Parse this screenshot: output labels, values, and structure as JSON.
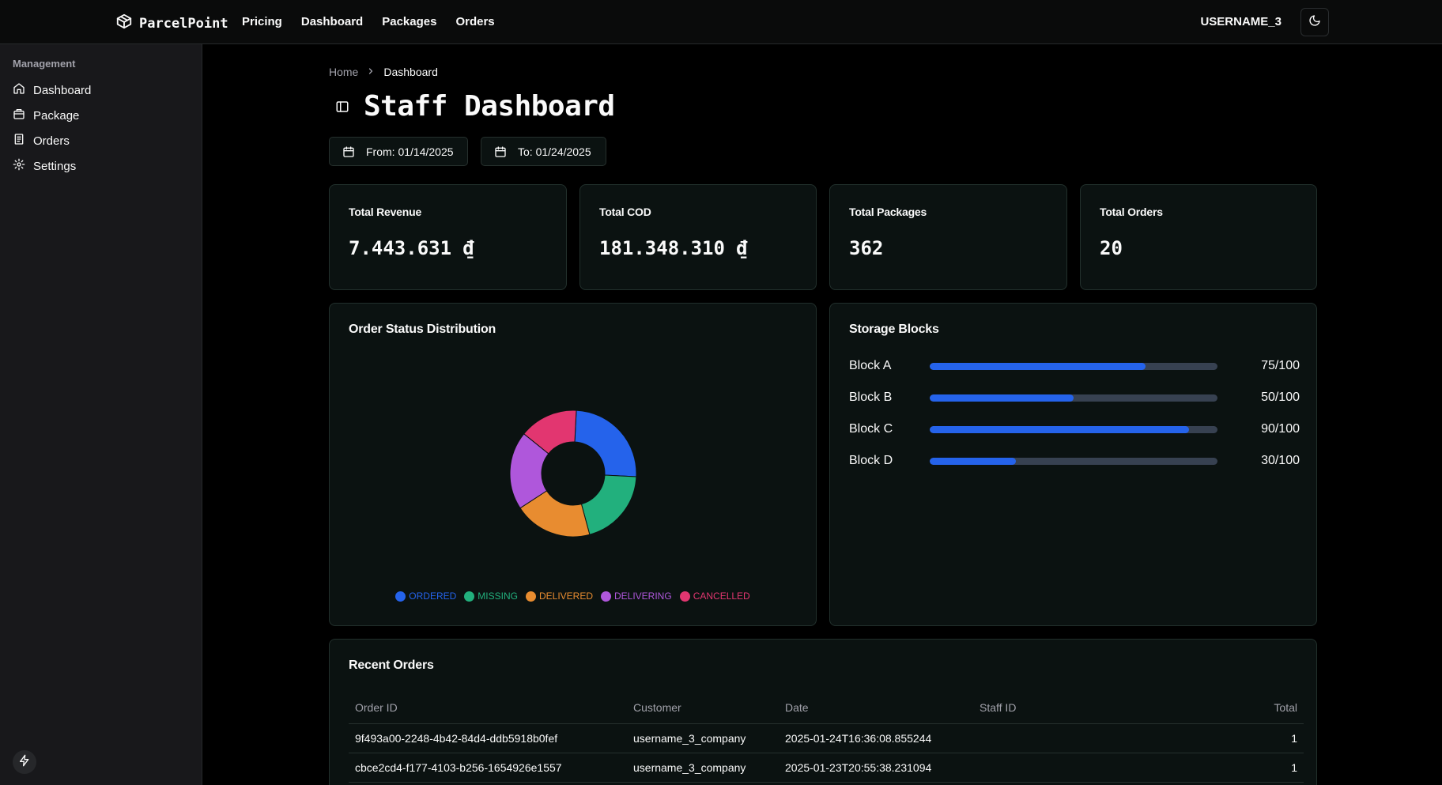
{
  "header": {
    "brand": "ParcelPoint",
    "nav": [
      "Pricing",
      "Dashboard",
      "Packages",
      "Orders"
    ],
    "username": "USERNAME_3"
  },
  "sidebar": {
    "group_label": "Management",
    "items": [
      {
        "label": "Dashboard",
        "icon": "home-icon"
      },
      {
        "label": "Package",
        "icon": "package-icon"
      },
      {
        "label": "Orders",
        "icon": "orders-icon"
      },
      {
        "label": "Settings",
        "icon": "gear-icon"
      }
    ]
  },
  "breadcrumb": {
    "home": "Home",
    "current": "Dashboard"
  },
  "page": {
    "title": "Staff Dashboard",
    "from_date": "From: 01/14/2025",
    "to_date": "To: 01/24/2025"
  },
  "stats": [
    {
      "label": "Total Revenue",
      "value": "7.443.631 ₫"
    },
    {
      "label": "Total COD",
      "value": "181.348.310 ₫"
    },
    {
      "label": "Total Packages",
      "value": "362"
    },
    {
      "label": "Total Orders",
      "value": "20"
    }
  ],
  "status_chart": {
    "title": "Order Status Distribution"
  },
  "chart_data": {
    "type": "pie",
    "title": "Order Status Distribution",
    "categories": [
      "ORDERED",
      "MISSING",
      "DELIVERED",
      "DELIVERING",
      "CANCELLED"
    ],
    "values": [
      5,
      4,
      4,
      4,
      3
    ],
    "colors": [
      "#2563eb",
      "#22b07d",
      "#e88c30",
      "#af57db",
      "#e23670"
    ],
    "legend": "bottom",
    "donut": true
  },
  "storage": {
    "title": "Storage Blocks",
    "blocks": [
      {
        "name": "Block A",
        "used": 75,
        "capacity": 100,
        "label": "75/100"
      },
      {
        "name": "Block B",
        "used": 50,
        "capacity": 100,
        "label": "50/100"
      },
      {
        "name": "Block C",
        "used": 90,
        "capacity": 100,
        "label": "90/100"
      },
      {
        "name": "Block D",
        "used": 30,
        "capacity": 100,
        "label": "30/100"
      }
    ]
  },
  "recent_orders": {
    "title": "Recent Orders",
    "columns": [
      "Order ID",
      "Customer",
      "Date",
      "Staff ID",
      "Total"
    ],
    "rows": [
      [
        "9f493a00-2248-4b42-84d4-ddb5918b0fef",
        "username_3_company",
        "2025-01-24T16:36:08.855244",
        "",
        "1"
      ],
      [
        "cbce2cd4-f177-4103-b256-1654926e1557",
        "username_3_company",
        "2025-01-23T20:55:38.231094",
        "",
        "1"
      ]
    ]
  }
}
